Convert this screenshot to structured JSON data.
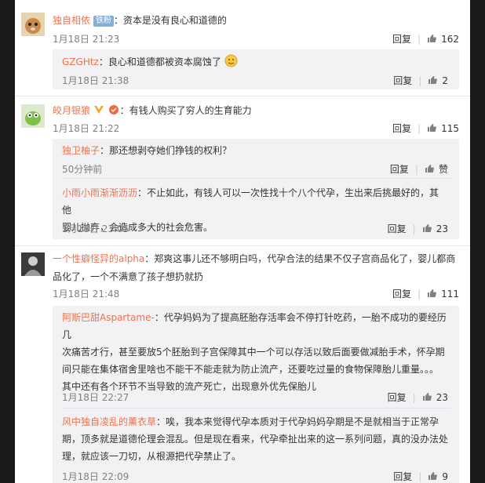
{
  "labels": {
    "reply": "回复"
  },
  "comments": [
    {
      "user": "独自相依",
      "badge": "铁粉",
      "text": "：资本是没有良心和道德的",
      "time": "1月18日 21:23",
      "likes": "162",
      "replies": [
        {
          "user": "GZGHtz",
          "text": "：良心和道德都被资本腐蚀了",
          "time": "1月18日 21:38",
          "likes": "2"
        }
      ]
    },
    {
      "user": "皎月银狼",
      "text": "：有钱人购买了穷人的生育能力",
      "time": "1月18日 21:22",
      "likes": "115",
      "replies": [
        {
          "user": "独卫柚子",
          "text": "：那还想剥夺她们挣钱的权利？",
          "time": "50分钟前",
          "likes": "赞"
        },
        {
          "user": "小雨小雨渐渐沥沥",
          "text_line1": "：不止如此，有钱人可以一次性找十个八个代孕，生出来后挑最好的，其他",
          "text_line2": "婴儿抛弃，会造成多大的社会危害。",
          "time": "1月18日 23:05",
          "likes": "23"
        }
      ]
    },
    {
      "user": "一个性癖怪异的alpha",
      "text_line1": "：郑爽这事儿还不够明白吗，代孕合法的结果不仅子宫商品化了，婴儿都商",
      "text_line2": "品化了，一个不满意了孩子想扔就扔",
      "time": "1月18日 21:48",
      "likes": "111",
      "replies": [
        {
          "user": "阿斯巴甜Aspartame-",
          "lines": [
            "：代孕妈妈为了提高胚胎存活率会不停打针吃药，一胎不成功的要经历几",
            "次痛苦才行，甚至要放5个胚胎到子宫保障其中一个可以存活以致后面要做减胎手术，怀孕期",
            "间只能在集体宿舍里啥也不能干不能走就为防止流产，还要吃过量的食物保障胎儿重量。。。",
            "其中还有各个环节不当导致的流产死亡，出现意外优先保胎儿"
          ],
          "time": "1月18日 22:27",
          "likes": "23"
        },
        {
          "user": "风中独自凌乱的薰衣草",
          "lines": [
            "：唉，我本来觉得代孕本质对于代孕妈妈孕期是不是就相当于正常孕",
            "期，顶多就是道德伦理会混乱。但是现在看来，代孕牵扯出来的这一系列问题，真的没办法处",
            "理，就应该一刀切，从根源把代孕禁止了。"
          ],
          "time": "1月18日 22:09",
          "likes": "9"
        }
      ]
    }
  ]
}
